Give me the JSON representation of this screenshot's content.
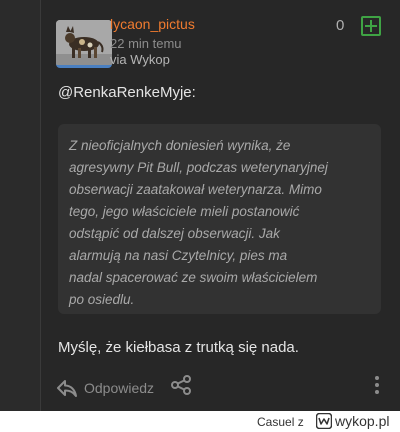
{
  "entry": {
    "author": "lycaon_pictus",
    "time_ago": "22 min temu",
    "source": "via Wykop",
    "vote_count": "0",
    "mention": "@RenkaRenkeMyje:",
    "quote_lines": [
      "Z nieoficjalnych doniesień wynika, że",
      "agresywny Pit Bull, podczas weterynaryjnej",
      "obserwacji zaatakował weterynarza. Mimo",
      "tego, jego właściciele mieli postanowić",
      "odstąpić od dalszej obserwacji. Jak",
      "alarmują na nasi Czytelnicy, pies ma",
      "nadal spacerować ze swoim właścicielem",
      "po osiedlu."
    ],
    "reply_text": "Myślę, że kiełbasa z trutką się nada.",
    "actions": {
      "reply_label": "Odpowiedz",
      "reply_icon": "reply-arrow-icon",
      "share_icon": "share-icon",
      "more_icon": "more-vertical-icon",
      "plus_icon": "plus-icon"
    }
  },
  "footer": {
    "user": "Casuel z",
    "brand": "wykop.pl"
  },
  "colors": {
    "background": "#272727",
    "author": "#f07b2f",
    "plus": "#3fa344",
    "avatar_border": "#4a7fc0"
  }
}
